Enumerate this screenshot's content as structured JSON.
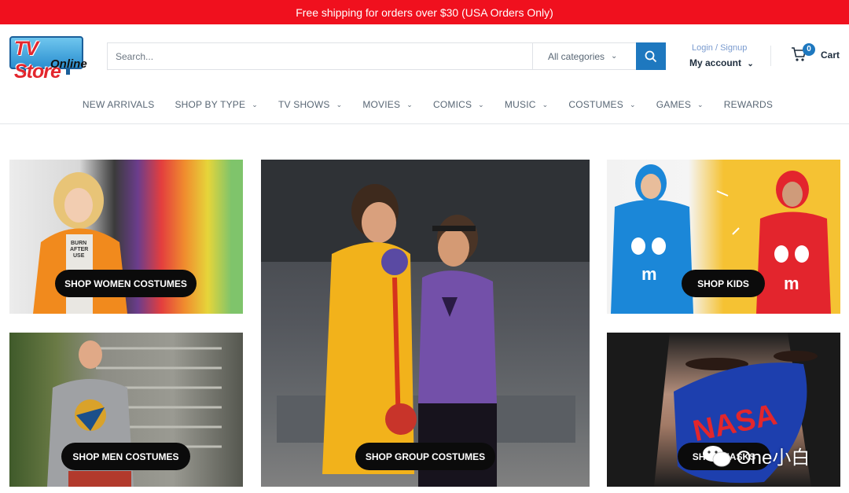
{
  "promo": {
    "text": "Free shipping for orders over $30 (USA Orders Only)"
  },
  "logo": {
    "line1": "TV Store",
    "line2": "Online"
  },
  "search": {
    "placeholder": "Search...",
    "category": "All categories",
    "icon": "search-icon"
  },
  "account": {
    "login": "Login / Signup",
    "label": "My account"
  },
  "cart": {
    "count": "0",
    "label": "Cart",
    "icon": "cart-icon"
  },
  "nav": [
    {
      "label": "NEW ARRIVALS",
      "dropdown": false
    },
    {
      "label": "SHOP BY TYPE",
      "dropdown": true
    },
    {
      "label": "TV SHOWS",
      "dropdown": true
    },
    {
      "label": "MOVIES",
      "dropdown": true
    },
    {
      "label": "COMICS",
      "dropdown": true
    },
    {
      "label": "MUSIC",
      "dropdown": true
    },
    {
      "label": "COSTUMES",
      "dropdown": true
    },
    {
      "label": "GAMES",
      "dropdown": true
    },
    {
      "label": "REWARDS",
      "dropdown": false
    }
  ],
  "tiles": {
    "women": "SHOP WOMEN COSTUMES",
    "men": "SHOP MEN COSTUMES",
    "group": "SHOP GROUP COSTUMES",
    "kids": "SHOP KIDS",
    "masks": "SHOP MASKS"
  },
  "shirt_text": "BURN AFTER USE",
  "mask_text": "NASA",
  "watermark": "One小白",
  "colors": {
    "promo_bg": "#f0101e",
    "accent": "#1e78bf",
    "cta_bg": "#0b0b0b"
  }
}
